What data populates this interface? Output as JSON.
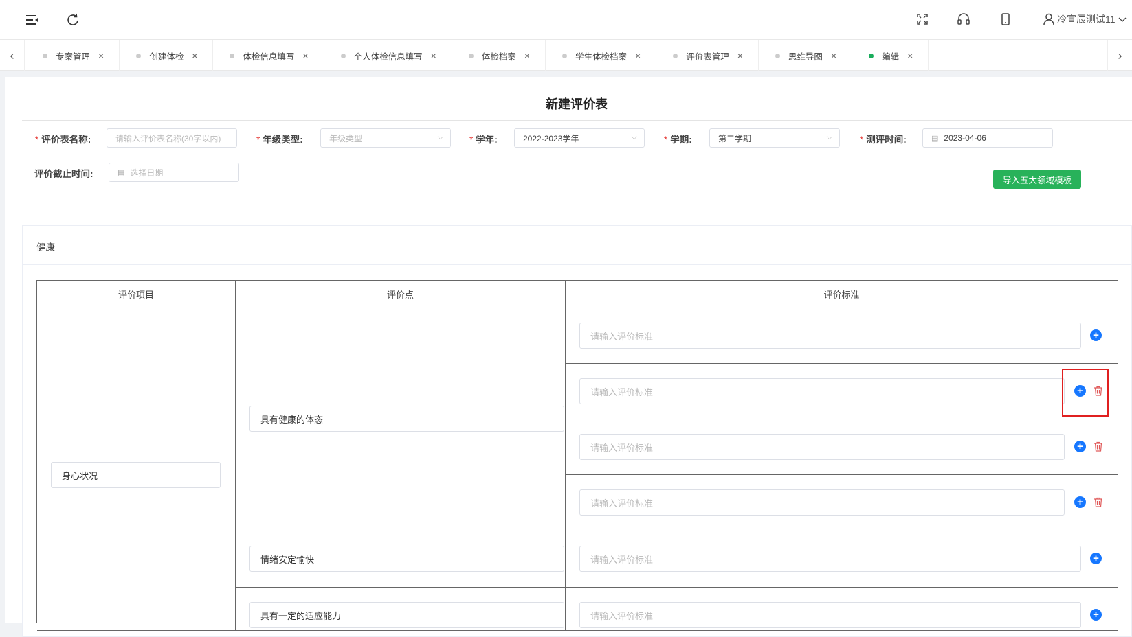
{
  "header": {
    "user_name": "冷宣辰测试11",
    "icons": [
      "menu-fold-icon",
      "refresh-icon",
      "fullscreen-icon",
      "headset-icon",
      "mobile-icon",
      "user-icon",
      "chevron-down-icon"
    ]
  },
  "tabs": {
    "items": [
      {
        "label": "专案管理",
        "active": false
      },
      {
        "label": "创建体检",
        "active": false
      },
      {
        "label": "体检信息填写",
        "active": false
      },
      {
        "label": "个人体检信息填写",
        "active": false
      },
      {
        "label": "体检档案",
        "active": false
      },
      {
        "label": "学生体检档案",
        "active": false
      },
      {
        "label": "评价表管理",
        "active": false
      },
      {
        "label": "思维导图",
        "active": false
      },
      {
        "label": "编辑",
        "active": true
      }
    ],
    "left_arrow": "‹",
    "right_arrow": "›",
    "close_glyph": "×"
  },
  "form": {
    "title": "新建评价表",
    "required_mark": "*",
    "name": {
      "label": "评价表名称:",
      "placeholder": "请输入评价表名称(30字以内)"
    },
    "grade_type": {
      "label": "年级类型:",
      "placeholder": "年级类型"
    },
    "school_year": {
      "label": "学年:",
      "value": "2022-2023学年"
    },
    "semester": {
      "label": "学期:",
      "value": "第二学期"
    },
    "eval_time": {
      "label": "测评时间:",
      "value": "2023-04-06"
    },
    "deadline": {
      "label": "评价截止时间:",
      "placeholder": "选择日期"
    },
    "import_button": "导入五大领域模板"
  },
  "section": {
    "title": "健康",
    "columns": [
      "评价项目",
      "评价点",
      "评价标准"
    ],
    "item_value": "身心状况",
    "points": [
      "具有健康的体态",
      "情绪安定愉快",
      "具有一定的适应能力"
    ],
    "standard_placeholder": "请输入评价标准"
  },
  "colors": {
    "accent": "#1677ff",
    "success": "#28b25a",
    "danger": "#e02020"
  }
}
